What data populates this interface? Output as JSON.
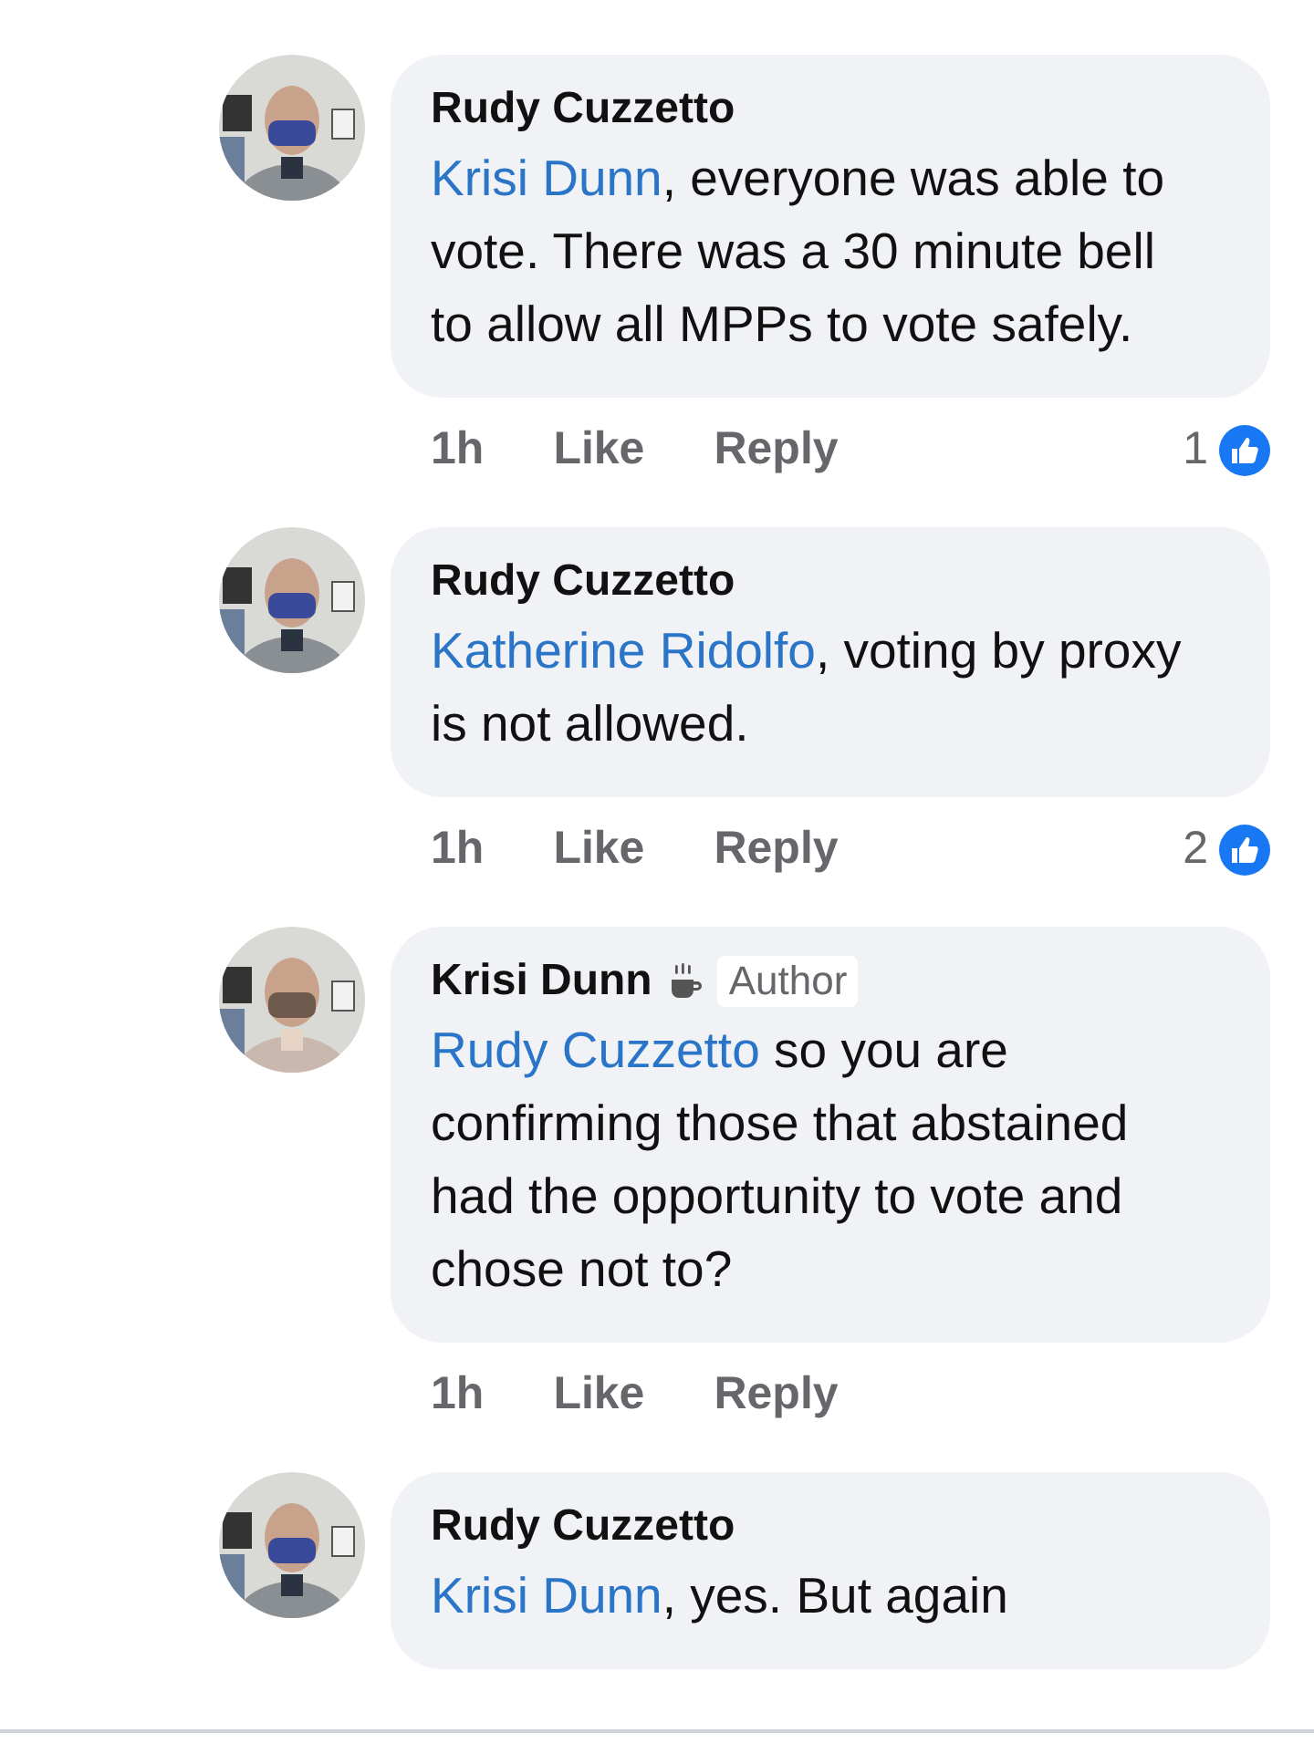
{
  "comments": [
    {
      "author": "Rudy Cuzzetto",
      "author_badge": false,
      "mention": "Krisi Dunn",
      "text": ", everyone was able to vote. There was a 30 minute bell to allow all MPPs to vote safely.",
      "time": "1h",
      "like": "Like",
      "reply": "Reply",
      "likes": "1"
    },
    {
      "author": "Rudy Cuzzetto",
      "author_badge": false,
      "mention": "Katherine Ridolfo",
      "text": ", voting by proxy is not allowed.",
      "time": "1h",
      "like": "Like",
      "reply": "Reply",
      "likes": "2"
    },
    {
      "author": "Krisi Dunn",
      "author_badge": true,
      "author_label": "Author",
      "mention": "Rudy Cuzzetto",
      "text": " so you are confirming those that abstained had the opportunity to vote and chose not to?",
      "time": "1h",
      "like": "Like",
      "reply": "Reply"
    },
    {
      "author": "Rudy Cuzzetto",
      "author_badge": false,
      "mention": "Krisi Dunn",
      "text": ", yes. But again"
    }
  ]
}
